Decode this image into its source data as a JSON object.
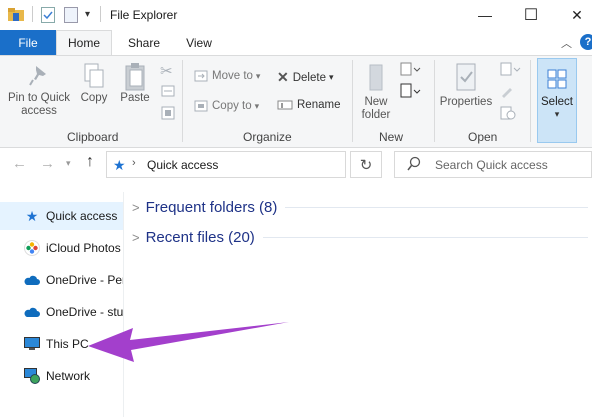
{
  "window": {
    "title": "File Explorer",
    "minimize": "—",
    "maximize": "☐",
    "close": "✕"
  },
  "ribbon_tabs": {
    "file": "File",
    "home": "Home",
    "share": "Share",
    "view": "View"
  },
  "clipboard": {
    "pin_line1": "Pin to Quick",
    "pin_line2": "access",
    "copy": "Copy",
    "paste": "Paste",
    "group": "Clipboard"
  },
  "organize": {
    "move_to": "Move to",
    "copy_to": "Copy to",
    "delete": "Delete",
    "rename": "Rename",
    "group": "Organize"
  },
  "new": {
    "new_folder_line1": "New",
    "new_folder_line2": "folder",
    "group": "New"
  },
  "open": {
    "properties": "Properties",
    "group": "Open"
  },
  "select": {
    "label": "Select"
  },
  "address": {
    "path": "Quick access",
    "search_placeholder": "Search Quick access"
  },
  "nav_pane": [
    {
      "label": "Quick access",
      "icon": "star-icon"
    },
    {
      "label": "iCloud Photos",
      "icon": "icloud-photos-icon"
    },
    {
      "label": "OneDrive - Per",
      "icon": "cloud-icon"
    },
    {
      "label": "OneDrive - stu",
      "icon": "cloud-icon"
    },
    {
      "label": "This PC",
      "icon": "monitor-icon"
    },
    {
      "label": "Network",
      "icon": "network-icon"
    }
  ],
  "content": {
    "frequent": "Frequent folders (8)",
    "recent": "Recent files (20)"
  },
  "colors": {
    "accent": "#1a6fc9",
    "annotation_arrow": "#a33fcc",
    "group_header": "#1e3287"
  }
}
